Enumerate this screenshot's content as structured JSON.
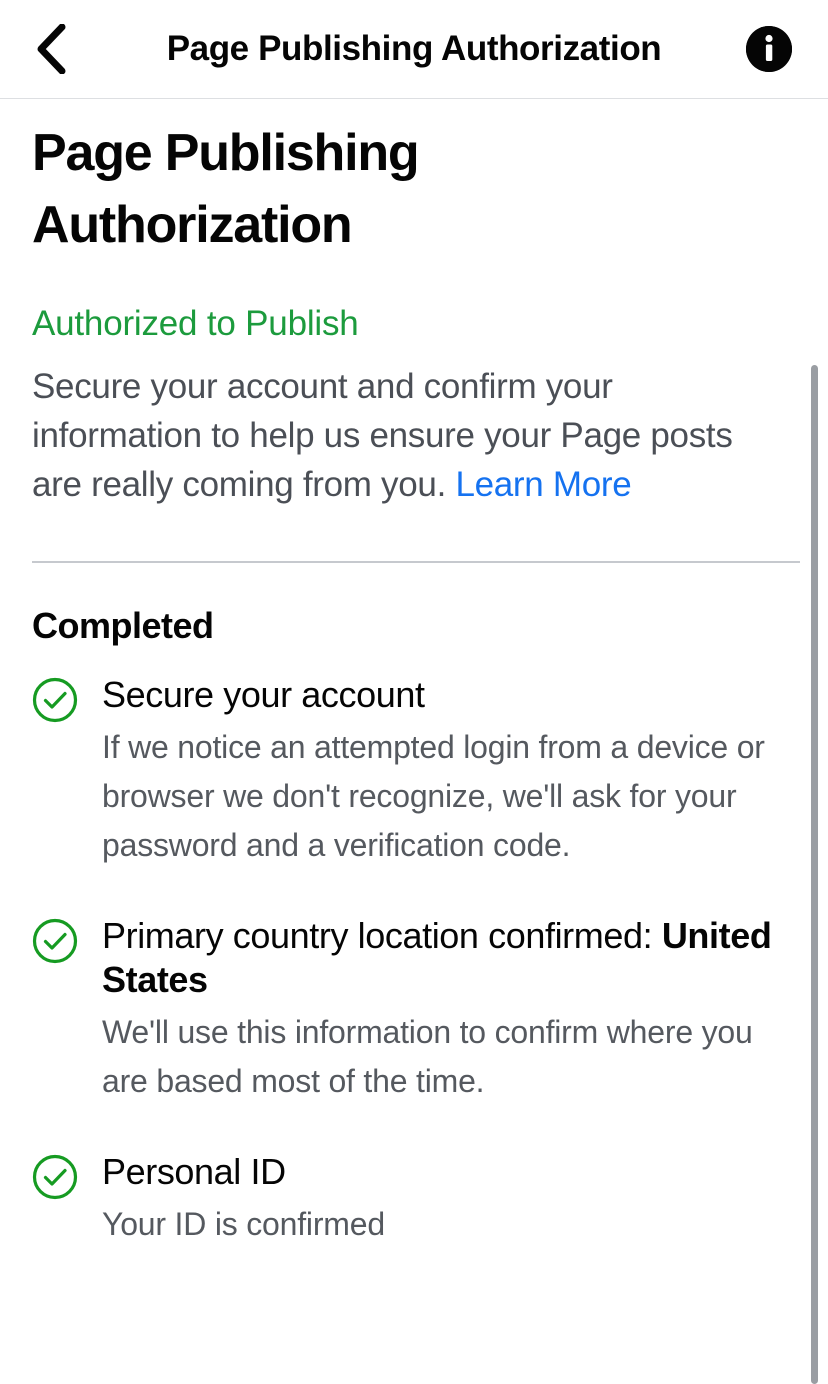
{
  "navbar": {
    "back_icon": "chevron-left-icon",
    "title": "Page Publishing Authorization",
    "info_icon": "info-circle-icon",
    "info_glyph": "i"
  },
  "page": {
    "title": "Page Publishing Authorization",
    "status": "Authorized to Publish",
    "status_color": "#1c9b3d",
    "intro_text": "Secure your account and confirm your information to help us ensure your Page posts are really coming from you. ",
    "intro_link": "Learn More",
    "link_color": "#1572f0",
    "section_title": "Completed"
  },
  "completed_items": [
    {
      "icon": "check-circle-icon",
      "heading": "Secure your account",
      "heading_emphasis": "",
      "description": "If we notice an attempted login from a device or browser we don't recognize, we'll ask for your password and a verification code."
    },
    {
      "icon": "check-circle-icon",
      "heading": "Primary country location confirmed: ",
      "heading_emphasis": "United States",
      "description": "We'll use this information to confirm where you are based most of the time."
    },
    {
      "icon": "check-circle-icon",
      "heading": "Personal ID",
      "heading_emphasis": "",
      "description": "Your ID is confirmed"
    }
  ],
  "scrollbar": {
    "name": "vertical-scrollbar"
  }
}
